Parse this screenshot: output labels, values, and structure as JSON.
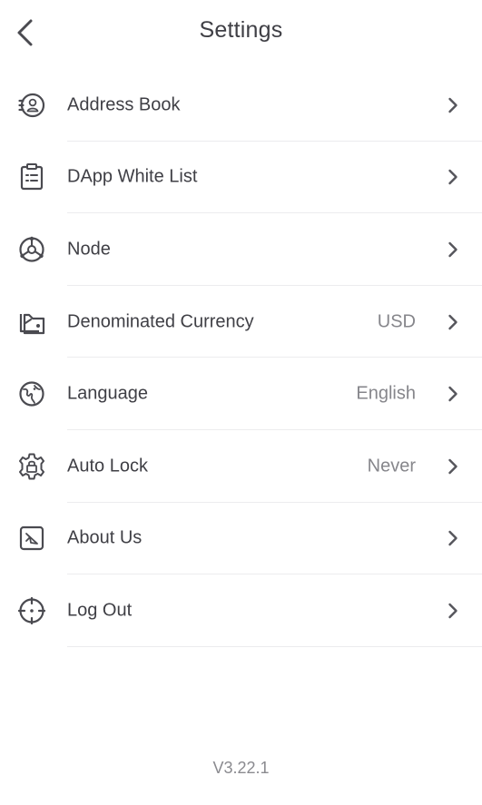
{
  "header": {
    "title": "Settings",
    "back_icon": "chevron-left-icon"
  },
  "settings": {
    "items": [
      {
        "label": "Address Book",
        "value": "",
        "icon": "address-book-icon"
      },
      {
        "label": "DApp White List",
        "value": "",
        "icon": "clipboard-list-icon"
      },
      {
        "label": "Node",
        "value": "",
        "icon": "node-icon"
      },
      {
        "label": "Denominated Currency",
        "value": "USD",
        "icon": "wallet-icon"
      },
      {
        "label": "Language",
        "value": "English",
        "icon": "globe-icon"
      },
      {
        "label": "Auto Lock",
        "value": "Never",
        "icon": "gear-lock-icon"
      },
      {
        "label": "About Us",
        "value": "",
        "icon": "paper-plane-icon"
      },
      {
        "label": "Log Out",
        "value": "",
        "icon": "crosshair-icon"
      }
    ]
  },
  "footer": {
    "version": "V3.22.1"
  },
  "colors": {
    "text": "#3f3f45",
    "secondary_text": "#86868b",
    "divider": "#ececee",
    "icon": "#4a4a50",
    "background": "#ffffff"
  }
}
